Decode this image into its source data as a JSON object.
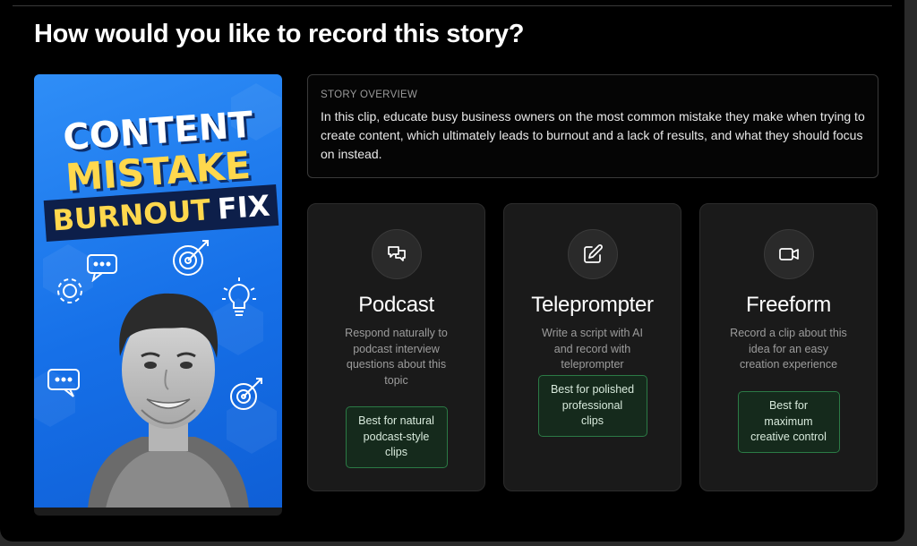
{
  "heading": "How would you like to record this story?",
  "thumbnail": {
    "line1": "CONTENT",
    "line2": "MISTAKE",
    "line3a": "BURNOUT",
    "line3b": "FIX"
  },
  "overview": {
    "label": "STORY OVERVIEW",
    "text": "In this clip, educate busy business owners on the most common mistake they make when trying to create content, which ultimately leads to burnout and a lack of results, and what they should focus on instead."
  },
  "options": [
    {
      "icon": "chat-bubbles-icon",
      "title": "Podcast",
      "description": "Respond naturally to podcast interview questions about this topic",
      "badge": "Best for natural podcast-style clips"
    },
    {
      "icon": "pencil-edit-icon",
      "title": "Teleprompter",
      "description": "Write a script with AI and record with teleprompter",
      "badge": "Best for polished professional clips"
    },
    {
      "icon": "video-camera-icon",
      "title": "Freeform",
      "description": "Record a clip about this idea for an easy creation experience",
      "badge": "Best for maximum creative control"
    }
  ],
  "colors": {
    "background": "#000000",
    "card": "#1a1a1a",
    "badge_border": "#2b7a45",
    "thumbnail_blue": "#1670e8",
    "thumbnail_yellow": "#ffd84d"
  }
}
